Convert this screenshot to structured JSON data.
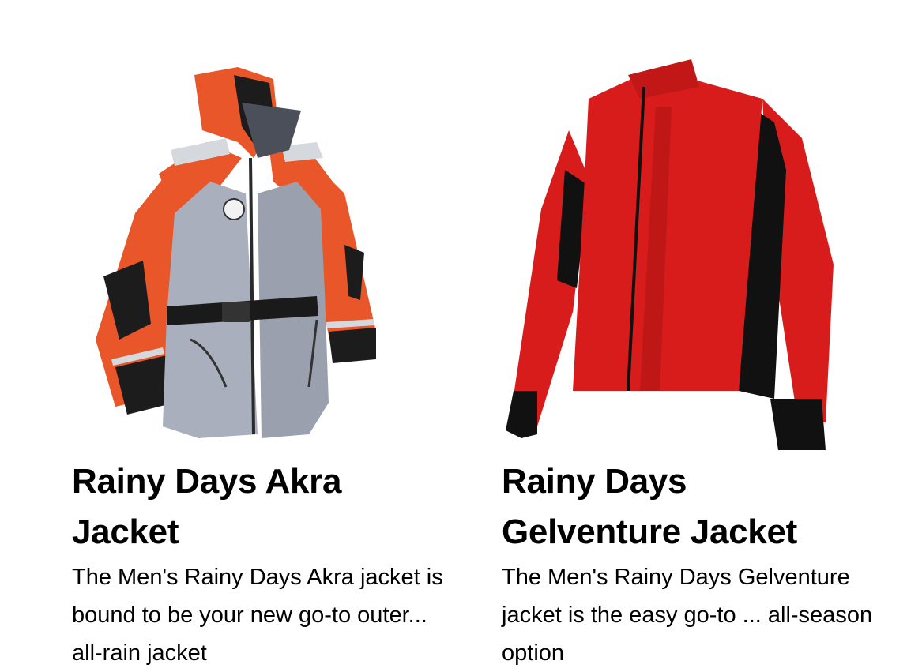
{
  "products": [
    {
      "title": "Rainy Days Akra Jacket",
      "description": "The Men's Rainy Days Akra jacket is bound to be your new go-to outer... all-rain jacket",
      "image_icon": "orange-grey-rain-jacket",
      "colors": {
        "primary": "#e8562a",
        "secondary": "#a9afbd",
        "accent": "#1a1a1a"
      }
    },
    {
      "title": "Rainy Days Gelventure Jacket",
      "description": "The Men's Rainy Days Gelventure jacket is the easy go-to ... all-season option",
      "image_icon": "red-black-softshell-jacket",
      "colors": {
        "primary": "#d81c1c",
        "secondary": "#111111",
        "accent": "#cfcfcf"
      }
    }
  ]
}
